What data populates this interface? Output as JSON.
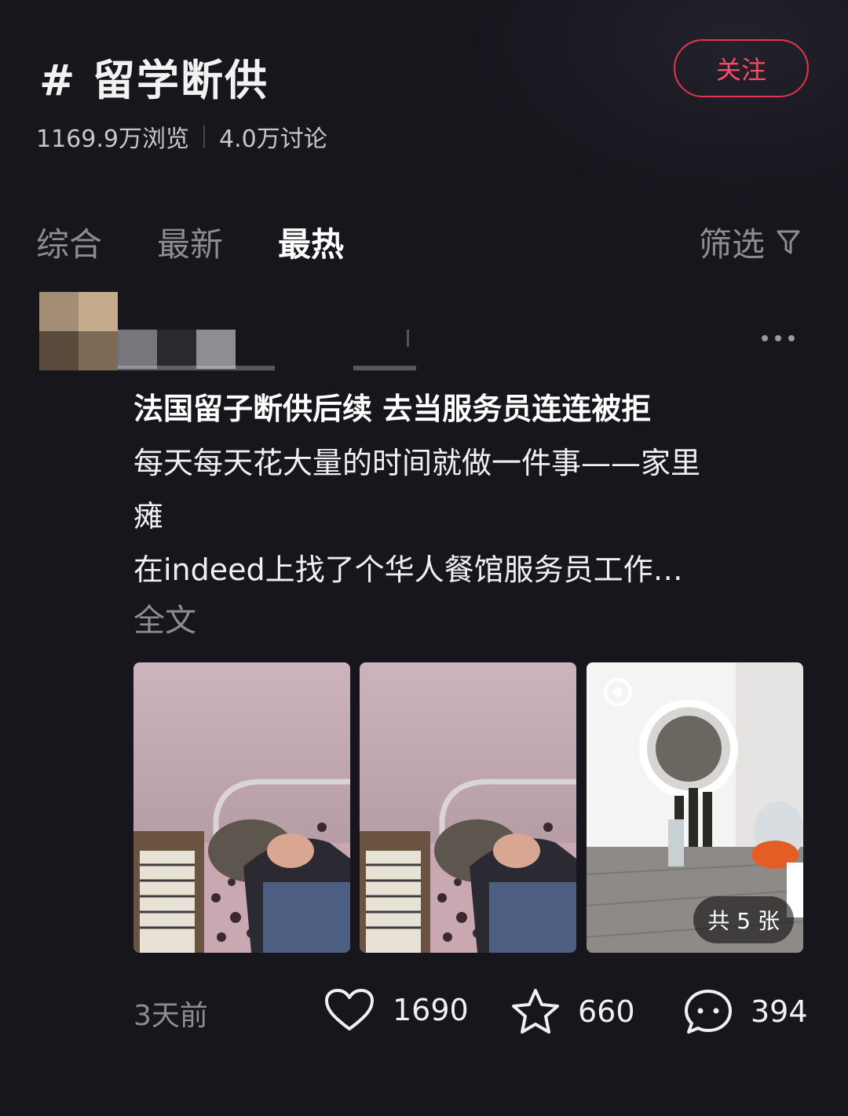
{
  "topic": {
    "title": "# 留学断供",
    "follow_label": "关注",
    "views": "1169.9万浏览",
    "discussions": "4.0万讨论"
  },
  "tabs": [
    {
      "label": "综合",
      "active": false
    },
    {
      "label": "最新",
      "active": false
    },
    {
      "label": "最热",
      "active": true
    }
  ],
  "filter_label": "筛选",
  "post": {
    "title": "法国留子断供后续 去当服务员连连被拒",
    "body": [
      "每天每天花大量的时间就做一件事——家里",
      "瘫",
      "在indeed上找了个华人餐馆服务员工作…"
    ],
    "full_text_label": "全文",
    "image_count_label": "共 5 张",
    "time": "3天前",
    "likes": "1690",
    "favorites": "660",
    "comments": "394"
  },
  "icons": {
    "filter": "funnel-icon",
    "more": "more-dots-icon",
    "like": "heart-icon",
    "favorite": "star-icon",
    "comment": "chat-bubble-icon"
  },
  "colors": {
    "background": "#17161d",
    "accent": "#ff4a63",
    "muted": "#8d8c93"
  }
}
